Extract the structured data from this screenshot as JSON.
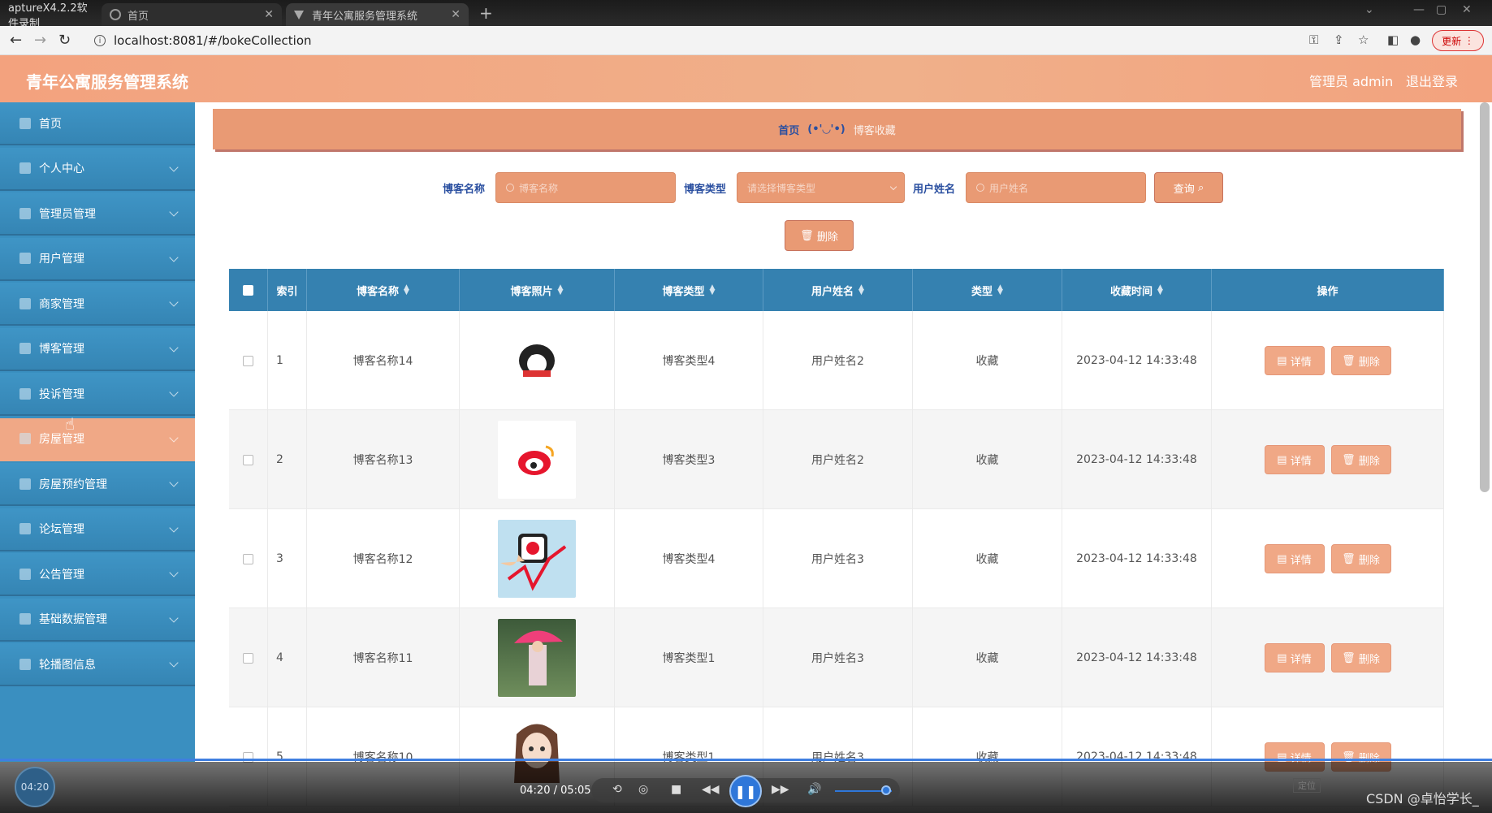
{
  "browser": {
    "tabs": [
      {
        "title": "aptureX4.2.2软件录制",
        "close": ""
      },
      {
        "title": "首页",
        "close": "✕"
      },
      {
        "title": "青年公寓服务管理系统",
        "close": "✕"
      }
    ],
    "new_tab": "+",
    "url": "localhost:8081/#/bokeCollection",
    "update_label": "更新"
  },
  "header": {
    "title": "青年公寓服务管理系统",
    "user": "管理员 admin",
    "logout": "退出登录"
  },
  "sidebar": {
    "items": [
      {
        "label": "首页",
        "icon": "home-icon",
        "active": false
      },
      {
        "label": "个人中心",
        "icon": "user-icon",
        "active": false
      },
      {
        "label": "管理员管理",
        "icon": "admin-icon",
        "active": false
      },
      {
        "label": "用户管理",
        "icon": "users-icon",
        "active": false
      },
      {
        "label": "商家管理",
        "icon": "shop-icon",
        "active": false
      },
      {
        "label": "博客管理",
        "icon": "blog-icon",
        "active": false
      },
      {
        "label": "投诉管理",
        "icon": "complaint-icon",
        "active": false
      },
      {
        "label": "房屋管理",
        "icon": "house-icon",
        "active": true
      },
      {
        "label": "房屋预约管理",
        "icon": "calendar-icon",
        "active": false
      },
      {
        "label": "论坛管理",
        "icon": "forum-icon",
        "active": false
      },
      {
        "label": "公告管理",
        "icon": "notice-icon",
        "active": false
      },
      {
        "label": "基础数据管理",
        "icon": "data-icon",
        "active": false
      },
      {
        "label": "轮播图信息",
        "icon": "carousel-icon",
        "active": false
      }
    ]
  },
  "breadcrumb": {
    "home": "首页",
    "sep": "(•'◡'•)",
    "current": "博客收藏"
  },
  "search": {
    "name_label": "博客名称",
    "name_placeholder": "博客名称",
    "type_label": "博客类型",
    "type_placeholder": "请选择博客类型",
    "user_label": "用户姓名",
    "user_placeholder": "用户姓名",
    "query_label": "查询",
    "delete_label": "删除"
  },
  "table": {
    "headers": [
      "索引",
      "博客名称",
      "博客照片",
      "博客类型",
      "用户姓名",
      "类型",
      "收藏时间",
      "操作"
    ],
    "detail_label": "详情",
    "delete_label": "删除",
    "rows": [
      {
        "index": "1",
        "name": "博客名称14",
        "photo": "penguin-logo",
        "type": "博客类型4",
        "user": "用户姓名2",
        "kind": "收藏",
        "time": "2023-04-12 14:33:48"
      },
      {
        "index": "2",
        "name": "博客名称13",
        "photo": "weibo-logo",
        "type": "博客类型3",
        "user": "用户姓名2",
        "kind": "收藏",
        "time": "2023-04-12 14:33:48"
      },
      {
        "index": "3",
        "name": "博客名称12",
        "photo": "weibo-phone",
        "type": "博客类型4",
        "user": "用户姓名3",
        "kind": "收藏",
        "time": "2023-04-12 14:33:48"
      },
      {
        "index": "4",
        "name": "博客名称11",
        "photo": "umbrella-photo",
        "type": "博客类型1",
        "user": "用户姓名3",
        "kind": "收藏",
        "time": "2023-04-12 14:33:48"
      },
      {
        "index": "5",
        "name": "博客名称10",
        "photo": "girl-cartoon",
        "type": "博客类型1",
        "user": "用户姓名3",
        "kind": "收藏",
        "time": "2023-04-12 14:33:48"
      }
    ]
  },
  "video": {
    "elapsed_badge": "04:20",
    "time": "04:20 / 05:05",
    "mini_label": "定位",
    "watermark": "CSDN @卓怡学长_"
  },
  "colors": {
    "header": "#f3a27e",
    "sidebar": "#3a8fc0",
    "table_header": "#3581b0",
    "accent": "#e99a74"
  }
}
